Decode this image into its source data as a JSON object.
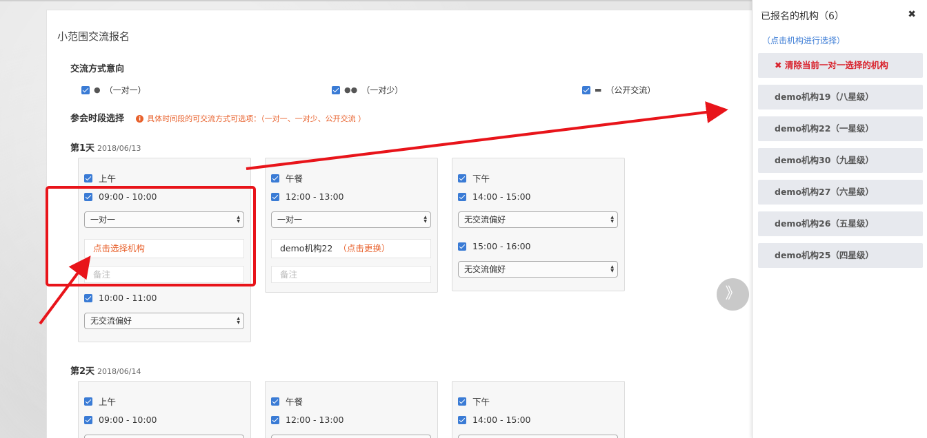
{
  "page": {
    "title": "小范围交流报名",
    "mode_section_label": "交流方式意向",
    "modes": [
      {
        "icon": "user-icon",
        "label": "（一对一）"
      },
      {
        "icon": "users-icon",
        "label": "（一对少）"
      },
      {
        "icon": "comments-icon",
        "label": "（公开交流）"
      }
    ],
    "time_section_label": "参会时段选择",
    "time_note": "具体时间段的可交流方式可选项：（一对一、一对少、公开交流 ）"
  },
  "days": [
    {
      "label": "第1天",
      "date": "2018/06/13",
      "periods": [
        {
          "name": "上午",
          "slots": [
            {
              "time": "09:00 - 10:00",
              "mode": "一对一",
              "org_prompt": "点击选择机构",
              "note_placeholder": "备注"
            },
            {
              "time": "10:00 - 11:00",
              "mode": "无交流偏好"
            }
          ]
        },
        {
          "name": "午餐",
          "slots": [
            {
              "time": "12:00 - 13:00",
              "mode": "一对一",
              "org_name": "demo机构22",
              "org_change": "（点击更换）",
              "note_placeholder": "备注"
            }
          ]
        },
        {
          "name": "下午",
          "slots": [
            {
              "time": "14:00 - 15:00",
              "mode": "无交流偏好"
            },
            {
              "time": "15:00 - 16:00",
              "mode": "无交流偏好"
            }
          ]
        }
      ]
    },
    {
      "label": "第2天",
      "date": "2018/06/14",
      "periods": [
        {
          "name": "上午",
          "slots": [
            {
              "time": "09:00 - 10:00"
            }
          ]
        },
        {
          "name": "午餐",
          "slots": [
            {
              "time": "12:00 - 13:00"
            }
          ]
        },
        {
          "name": "下午",
          "slots": [
            {
              "time": "14:00 - 15:00"
            }
          ]
        }
      ]
    }
  ],
  "pager": {
    "icon": "double-chevron-right-icon",
    "glyph": "》"
  },
  "side_panel": {
    "title": "已报名的机构（6）",
    "close_glyph": "✖",
    "hint": "（点击机构进行选择）",
    "clear_label": "清除当前一对一选择的机构",
    "orgs": [
      "demo机构19（八星级）",
      "demo机构22（一星级）",
      "demo机构30（九星级）",
      "demo机构27（六星级）",
      "demo机构26（五星级）",
      "demo机构25（四星级）"
    ]
  },
  "colors": {
    "accent_blue": "#3a7bd5",
    "warning_orange": "#e8612c",
    "danger_red": "#d9232d",
    "annotation_red": "#e8141a"
  }
}
